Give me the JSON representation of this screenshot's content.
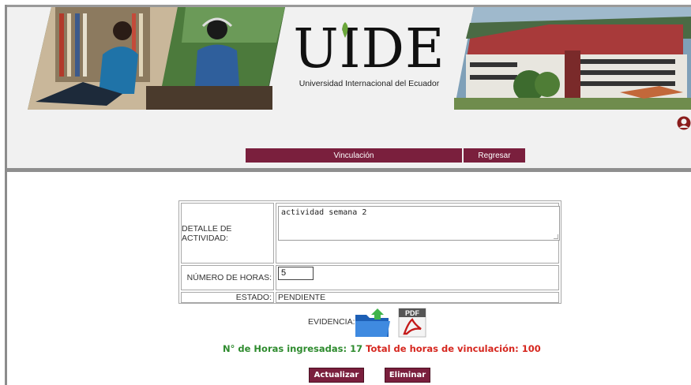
{
  "header": {
    "logo_text": "UIDE",
    "logo_subtitle": "Universidad Internacional del Ecuador"
  },
  "menu": {
    "items": [
      {
        "label": "Vinculación"
      },
      {
        "label": "Regresar"
      }
    ]
  },
  "form": {
    "detail_label": "DETALLE DE ACTIVIDAD:",
    "detail_value": "actividad semana 2",
    "hours_label": "NÚMERO DE HORAS:",
    "hours_value": "5",
    "status_label": "ESTADO:",
    "status_value": "PENDIENTE"
  },
  "evidence": {
    "label": "EVIDENCIA:",
    "upload_icon": "folder-upload-icon",
    "pdf_icon": "pdf-icon",
    "pdf_text": "PDF"
  },
  "totals": {
    "entered_label": "N° de Horas ingresadas:",
    "entered_value": "17",
    "total_label": "Total de horas de vinculación:",
    "total_value": "100"
  },
  "buttons": {
    "update": "Actualizar",
    "delete": "Eliminar"
  },
  "colors": {
    "brand": "#7a1f3d",
    "green": "#2e8b2e",
    "red": "#d6271f"
  }
}
